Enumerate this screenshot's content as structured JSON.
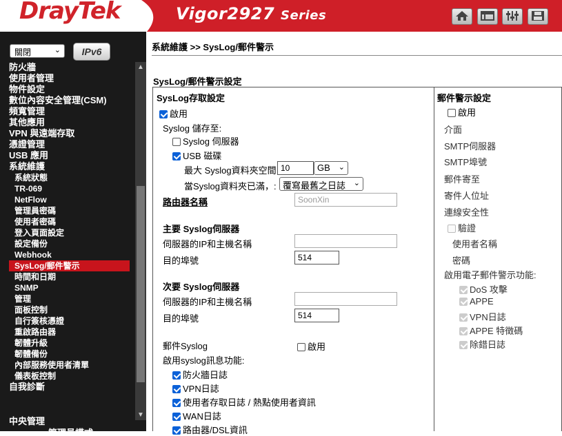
{
  "header": {
    "logo": "DrayTek",
    "model": "Vigor2927",
    "series": "Series",
    "icons": [
      "home-icon",
      "layout-icon",
      "sliders-icon",
      "save-icon"
    ]
  },
  "sidebar": {
    "language": "關閉",
    "ipv6_label": "IPv6",
    "items": [
      {
        "label": "防火牆",
        "sub": false
      },
      {
        "label": "使用者管理",
        "sub": false
      },
      {
        "label": "物件設定",
        "sub": false
      },
      {
        "label": "數位內容安全管理(CSM)",
        "sub": false
      },
      {
        "label": "頻寬管理",
        "sub": false
      },
      {
        "label": "其他應用",
        "sub": false
      },
      {
        "label": "VPN 與遠端存取",
        "sub": false
      },
      {
        "label": "憑證管理",
        "sub": false
      },
      {
        "label": "USB 應用",
        "sub": false
      },
      {
        "label": "系統維護",
        "sub": false
      },
      {
        "label": "系統狀態",
        "sub": true
      },
      {
        "label": "TR-069",
        "sub": true
      },
      {
        "label": "NetFlow",
        "sub": true
      },
      {
        "label": "管理員密碼",
        "sub": true
      },
      {
        "label": "使用者密碼",
        "sub": true
      },
      {
        "label": "登入頁面設定",
        "sub": true
      },
      {
        "label": "設定備份",
        "sub": true
      },
      {
        "label": "Webhook",
        "sub": true
      },
      {
        "label": "SysLog/郵件警示",
        "sub": true,
        "active": true
      },
      {
        "label": "時間和日期",
        "sub": true
      },
      {
        "label": "SNMP",
        "sub": true
      },
      {
        "label": "管理",
        "sub": true
      },
      {
        "label": "面板控制",
        "sub": true
      },
      {
        "label": "自行簽核憑證",
        "sub": true
      },
      {
        "label": "重啟路由器",
        "sub": true
      },
      {
        "label": "韌體升級",
        "sub": true
      },
      {
        "label": "韌體備份",
        "sub": true
      },
      {
        "label": "內部服務使用者清單",
        "sub": true
      },
      {
        "label": "儀表板控制",
        "sub": true
      },
      {
        "label": "自我診斷",
        "sub": false
      }
    ],
    "bottom1": "中央管理",
    "bottom2": "管理員模式"
  },
  "main": {
    "breadcrumb": "系統維護 >> SysLog/郵件警示",
    "title": "SysLog/郵件警示設定",
    "syslog": {
      "heading": "SysLog存取設定",
      "enable": "啟用",
      "save_to": "Syslog 儲存至:",
      "syslog_server": "Syslog 伺服器",
      "usb_disk": "USB 磁碟",
      "max_label": "最大 Syslog資料夾空間",
      "max_value": "10",
      "unit": "GB",
      "full_label": "當Syslog資料夾已滿，:",
      "full_option": "覆寫最舊之日誌",
      "router_name_label": "路由器名稱",
      "router_name_placeholder": "SoonXin",
      "primary_heading": "主要 Syslog伺服器",
      "primary_host_label": "伺服器的IP和主機名稱",
      "primary_port_label": "目的埠號",
      "primary_port": "514",
      "secondary_heading": "次要 Syslog伺服器",
      "secondary_host_label": "伺服器的IP和主機名稱",
      "secondary_port_label": "目的埠號",
      "secondary_port": "514",
      "mail_syslog_label": "郵件Syslog",
      "mail_syslog_enable": "啟用",
      "functions_label": "啟用syslog訊息功能:",
      "functions": [
        "防火牆日誌",
        "VPN日誌",
        "使用者存取日誌 / 熱點使用者資訊",
        "WAN日誌",
        "路由器/DSL資訊"
      ]
    },
    "mail": {
      "heading": "郵件警示設定",
      "enable": "啟用",
      "interface": "介面",
      "smtp_server": "SMTP伺服器",
      "smtp_port": "SMTP埠號",
      "mail_to": "郵件寄至",
      "sender": "寄件人位址",
      "security": "連線安全性",
      "auth": "驗證",
      "username": "使用者名稱",
      "password": "密碼",
      "alert_label": "啟用電子郵件警示功能:",
      "alerts": [
        "DoS 攻擊",
        "APPE",
        "VPN日誌",
        "APPE 特徵碼",
        "除錯日誌"
      ]
    }
  }
}
